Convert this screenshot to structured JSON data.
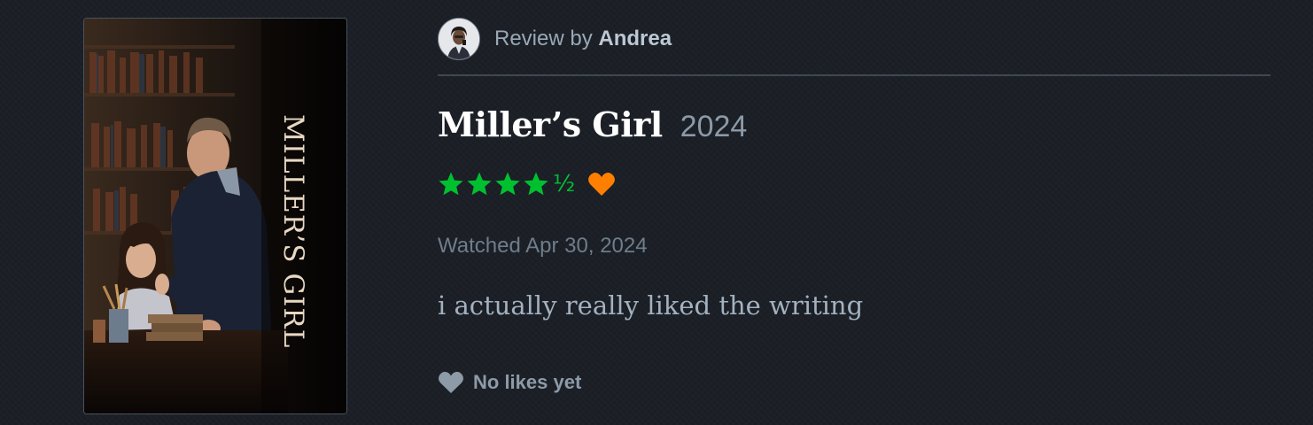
{
  "poster": {
    "title_text": "MILLER'S GIRL"
  },
  "review": {
    "prefix": "Review by",
    "reviewer_name": "Andrea",
    "film_title": "Miller’s Girl",
    "year": "2024",
    "rating_stars": 4.5,
    "half_star_glyph": "½",
    "liked": true,
    "watched_label": "Watched Apr 30, 2024",
    "body": "i actually really liked the writing",
    "likes_label": "No likes yet"
  },
  "colors": {
    "star": "#00c030",
    "liked_heart": "#ff8000",
    "likes_heart": "#8d9aa7"
  }
}
